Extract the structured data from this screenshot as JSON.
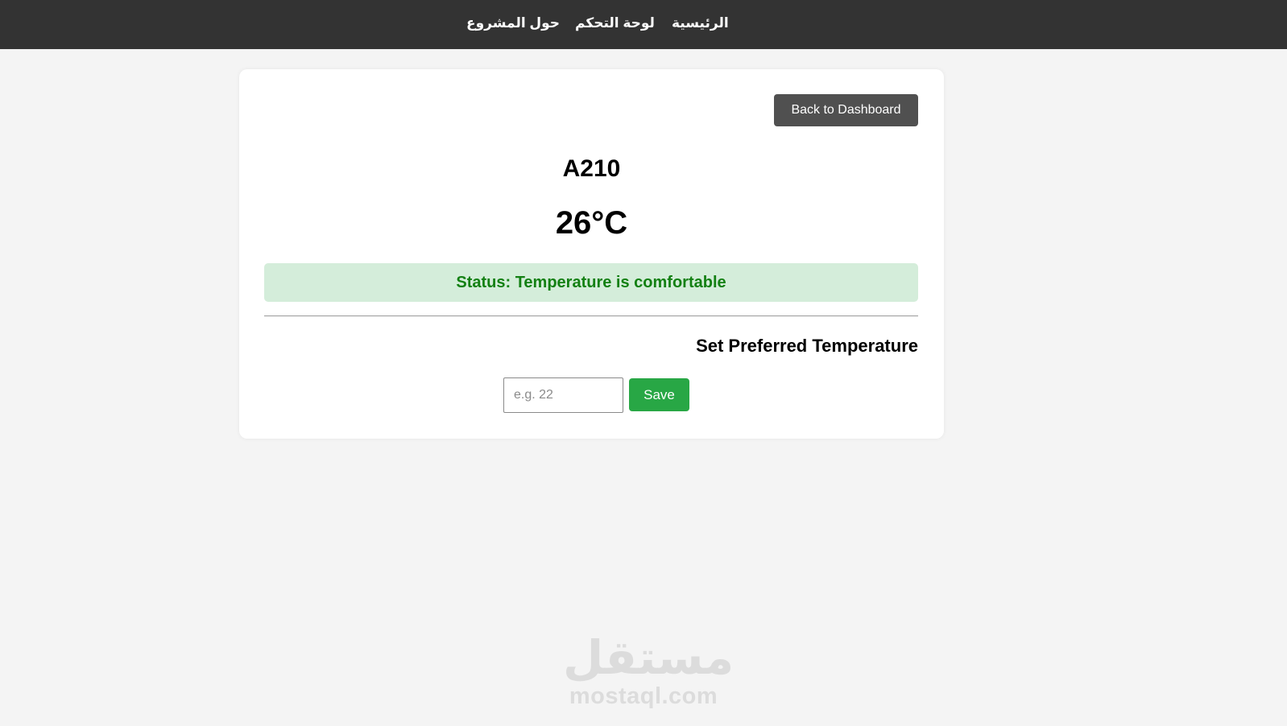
{
  "nav": {
    "items": [
      {
        "label": "الرئيسية"
      },
      {
        "label": "لوحة التحكم"
      },
      {
        "label": "حول المشروع"
      }
    ]
  },
  "card": {
    "back_label": "Back to Dashboard",
    "room_name": "A210",
    "temperature": "26°C",
    "status_text": "Status: Temperature is comfortable",
    "preference_heading": "Set Preferred Temperature",
    "input": {
      "value": "",
      "placeholder": "e.g. 22"
    },
    "save_label": "Save"
  },
  "watermark": {
    "logo": "مستقل",
    "text": "mostaql.com"
  },
  "colors": {
    "navbar": "#333333",
    "back_button": "#505050",
    "status_background": "#d4edda",
    "status_text": "#138013",
    "save_button": "#28a745"
  }
}
